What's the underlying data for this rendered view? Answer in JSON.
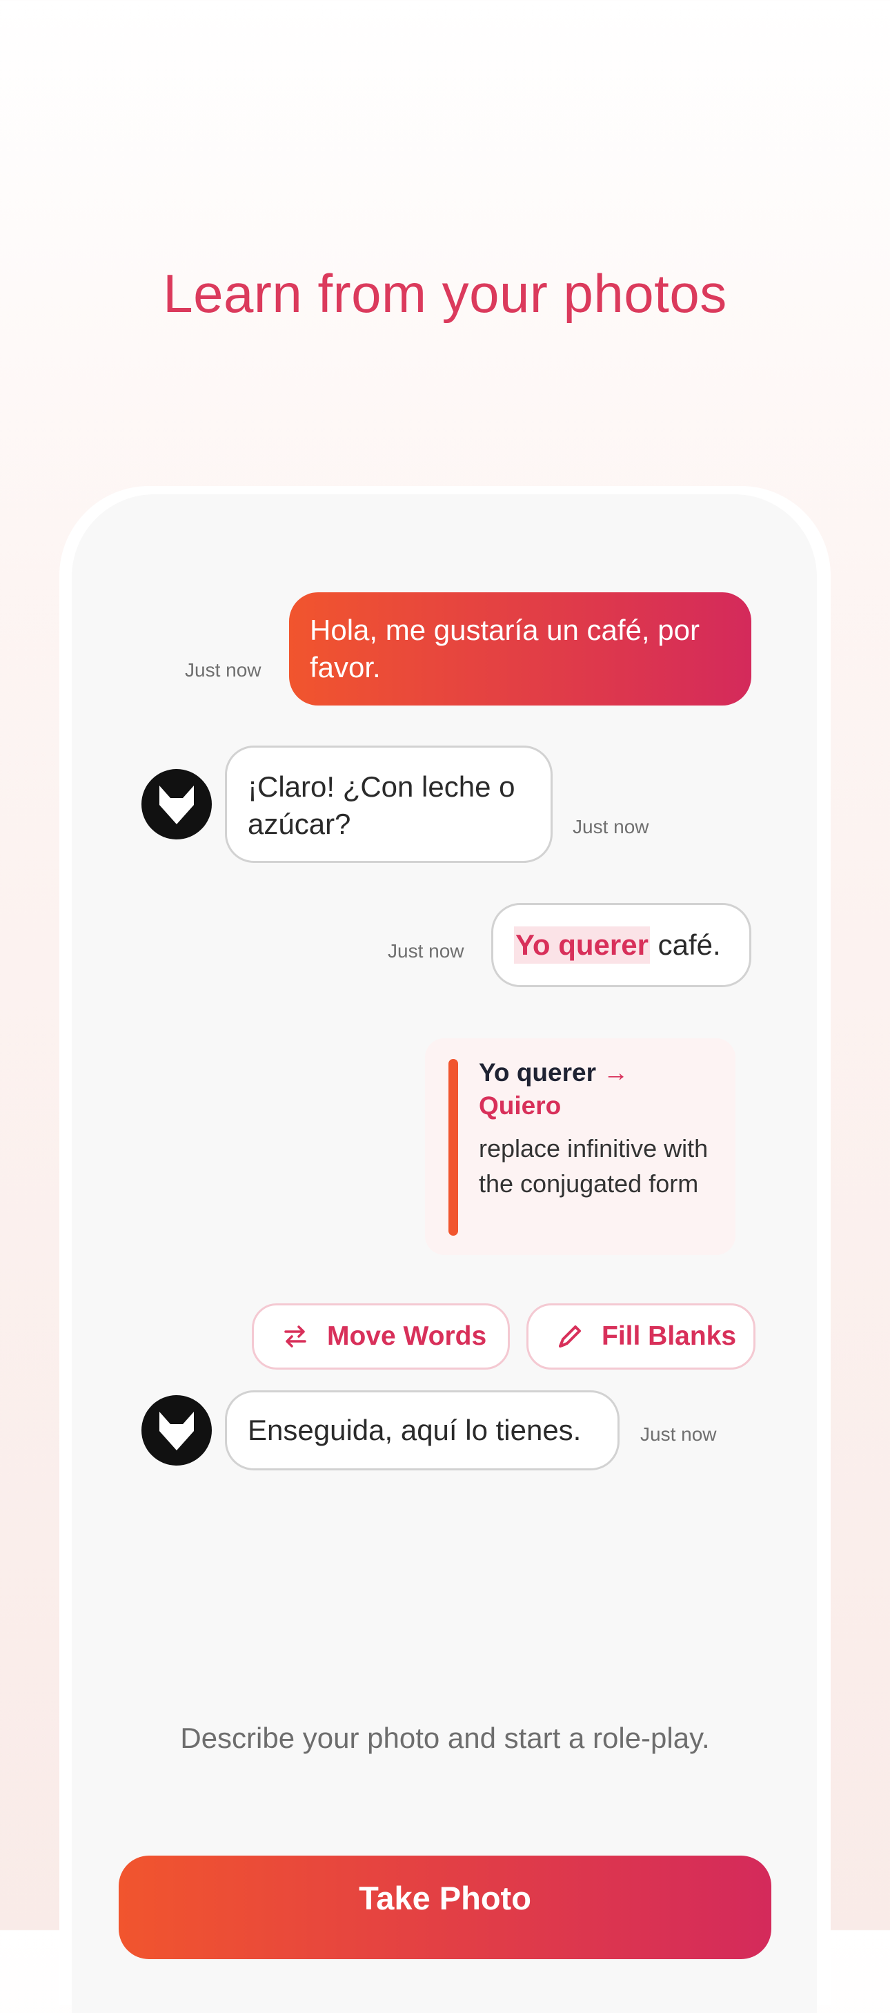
{
  "headline": "Learn from your photos",
  "chat": {
    "messages": [
      {
        "role": "user",
        "text": "Hola, me gustaría un café, por favor.",
        "time": "Just now"
      },
      {
        "role": "bot",
        "text": "¡Claro! ¿Con leche o azúcar?",
        "time": "Just now"
      },
      {
        "role": "user",
        "error_text": "Yo querer",
        "rest_text": " café.",
        "time": "Just now"
      },
      {
        "role": "bot",
        "text": "Enseguida, aquí lo tienes.",
        "time": "Just now"
      }
    ],
    "correction": {
      "original": "Yo querer",
      "arrow": " →",
      "corrected": "Quiero",
      "explanation": "replace infinitive with the conjugated form"
    },
    "actions": {
      "move_words_label": "Move Words",
      "fill_blanks_label": "Fill Blanks"
    }
  },
  "prompt_text": "Describe your photo and start a role-play.",
  "cta_label": "Take Photo",
  "colors": {
    "accent": "#db3a5c",
    "gradient_start": "#f1552e",
    "gradient_end": "#d42a5b",
    "avatar_bg": "#111111"
  },
  "icons": {
    "avatar": "fox-icon",
    "move_words": "swap-arrows-icon",
    "fill_blanks": "pencil-icon"
  }
}
